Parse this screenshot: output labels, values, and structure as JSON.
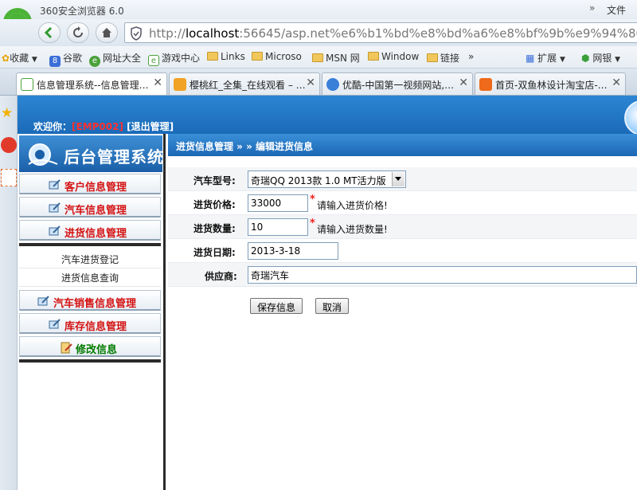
{
  "browser": {
    "title": "360安全浏览器 6.0",
    "title_arrows": "»",
    "menu_label": "文件",
    "url_scheme": "http://",
    "url_host": "localhost",
    "url_rest": ":56645/asp.net%e6%b1%bd%e8%bd%a6%e8%bf%9b%e9%94%80%e",
    "bookmarks": [
      {
        "label": "收藏",
        "icon": "star-icon"
      },
      {
        "label": "谷歌",
        "icon": "google-icon"
      },
      {
        "label": "网址大全",
        "icon": "site-icon"
      },
      {
        "label": "游戏中心",
        "icon": "game-icon"
      },
      {
        "label": "Links",
        "icon": "folder-icon"
      },
      {
        "label": "Microso",
        "icon": "folder-icon"
      },
      {
        "label": "MSN 网",
        "icon": "folder-icon"
      },
      {
        "label": "Window",
        "icon": "folder-icon"
      },
      {
        "label": "链接",
        "icon": "folder-icon"
      }
    ],
    "bookmarks_more": "»",
    "extend_label": "扩展",
    "bank_label": "网银",
    "tabs": [
      {
        "label": "信息管理系统--信息管理…",
        "close": "✕"
      },
      {
        "label": "樱桃红_全集_在线观看 – …",
        "close": "✕"
      },
      {
        "label": "优酷-中国第一视频网站,…",
        "close": "✕"
      },
      {
        "label": "首页-双鱼林设计淘宝店-…",
        "close": "✕"
      }
    ]
  },
  "header": {
    "welcome_prefix": "欢迎你：",
    "user": "[EMP002]",
    "logout": "[退出管理]"
  },
  "sidebar": {
    "title": "后台管理系统",
    "menus": [
      {
        "label": "客户信息管理"
      },
      {
        "label": "汽车信息管理"
      },
      {
        "label": "进货信息管理"
      }
    ],
    "submenu": [
      {
        "label": "汽车进货登记"
      },
      {
        "label": "进货信息查询"
      }
    ],
    "menus2": [
      {
        "label": "汽车销售信息管理"
      },
      {
        "label": "库存信息管理"
      },
      {
        "label": "修改信息"
      }
    ]
  },
  "main": {
    "breadcrumb": "进货信息管理 » » 编辑进货信息",
    "fields": {
      "model_label": "汽车型号:",
      "model_value": "奇瑞QQ 2013款 1.0 MT活力版",
      "price_label": "进货价格:",
      "price_value": "33000",
      "price_required": "*",
      "price_hint": "请输入进货价格!",
      "qty_label": "进货数量:",
      "qty_value": "10",
      "qty_required": "*",
      "qty_hint": "请输入进货数量!",
      "date_label": "进货日期:",
      "date_value": "2013-3-18",
      "supplier_label": "供应商:",
      "supplier_value": "奇瑞汽车"
    },
    "save_button": "保存信息",
    "cancel_button": "取消"
  }
}
